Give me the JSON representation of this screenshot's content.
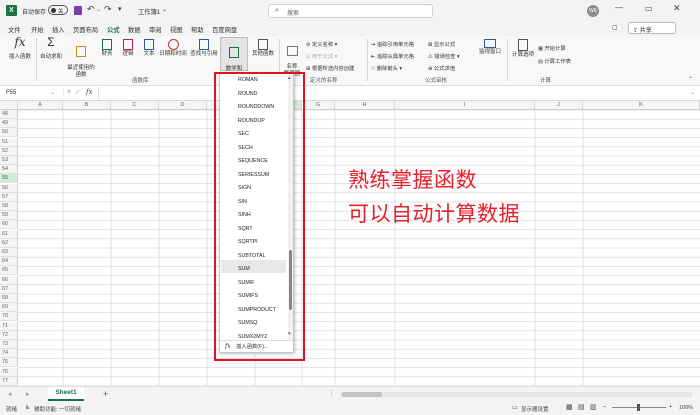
{
  "titlebar": {
    "autosave_label": "自动保存",
    "autosave_state": "关",
    "doc_title": "工作簿1",
    "search_placeholder": "搜索",
    "user_initials": "WE"
  },
  "tabs": [
    "文件",
    "开始",
    "插入",
    "页面布局",
    "公式",
    "数据",
    "审阅",
    "视图",
    "帮助",
    "百度网盘"
  ],
  "active_tab": "公式",
  "share_label": "共享",
  "ribbon": {
    "insert_fn": "插入函数",
    "autosum": "自动求和",
    "recent": "最近使用的\n函数",
    "financial": "财务",
    "logical": "逻辑",
    "text": "文本",
    "datetime": "日期和时间",
    "lookup": "查找与引用",
    "math": "数学和\n三角函数",
    "more": "其他函数",
    "name_mgr": "名称\n管理器",
    "define_name": "定义名称",
    "use_in_formula": "用于公式",
    "create_from_sel": "根据所选内容创建",
    "trace_precedents": "追踪引用单元格",
    "trace_dependents": "追踪从属单元格",
    "remove_arrows": "删除箭头",
    "show_formulas": "显示公式",
    "error_checking": "错误检查",
    "evaluate": "公式求值",
    "watch": "监视窗口",
    "calc_options": "计算选项",
    "calc_now": "开始计算",
    "calc_sheet": "计算工作表",
    "group_library": "函数库",
    "group_names": "定义的名称",
    "group_audit": "公式审核",
    "group_calc": "计算"
  },
  "formula_bar": {
    "name_box": "F55",
    "fx": "fx"
  },
  "columns": [
    "A",
    "B",
    "C",
    "D",
    "E",
    "F",
    "G",
    "H",
    "I",
    "J",
    "K"
  ],
  "rows": [
    "48",
    "49",
    "50",
    "51",
    "52",
    "53",
    "54",
    "55",
    "56",
    "57",
    "58",
    "59",
    "60",
    "61",
    "62",
    "63",
    "64",
    "65",
    "66",
    "67",
    "68",
    "69",
    "70",
    "71",
    "72",
    "73",
    "74",
    "75",
    "76",
    "77"
  ],
  "dropdown": {
    "items": [
      "ROMAN",
      "ROUND",
      "ROUNDDOWN",
      "ROUNDUP",
      "SEC",
      "SECH",
      "SEQUENCE",
      "SERIESSUM",
      "SIGN",
      "SIN",
      "SINH",
      "SQRT",
      "SQRTPI",
      "SUBTOTAL",
      "SUM",
      "SUMIF",
      "SUMIFS",
      "SUMPRODUCT",
      "SUMSQ",
      "SUMX2MY2"
    ],
    "highlighted": "SUM",
    "insert_function": "插入函数(F)..."
  },
  "overlay_text": {
    "line1": "熟练掌握函数",
    "line2": "可以自动计算数据"
  },
  "sheet_tab": "Sheet1",
  "status": {
    "ready": "就绪",
    "accessibility": "辅助功能: 一切就绪",
    "display_settings": "显示器设置",
    "zoom": "100%"
  },
  "colors": {
    "accent": "#1e7145",
    "highlight_red": "#e0141e"
  }
}
